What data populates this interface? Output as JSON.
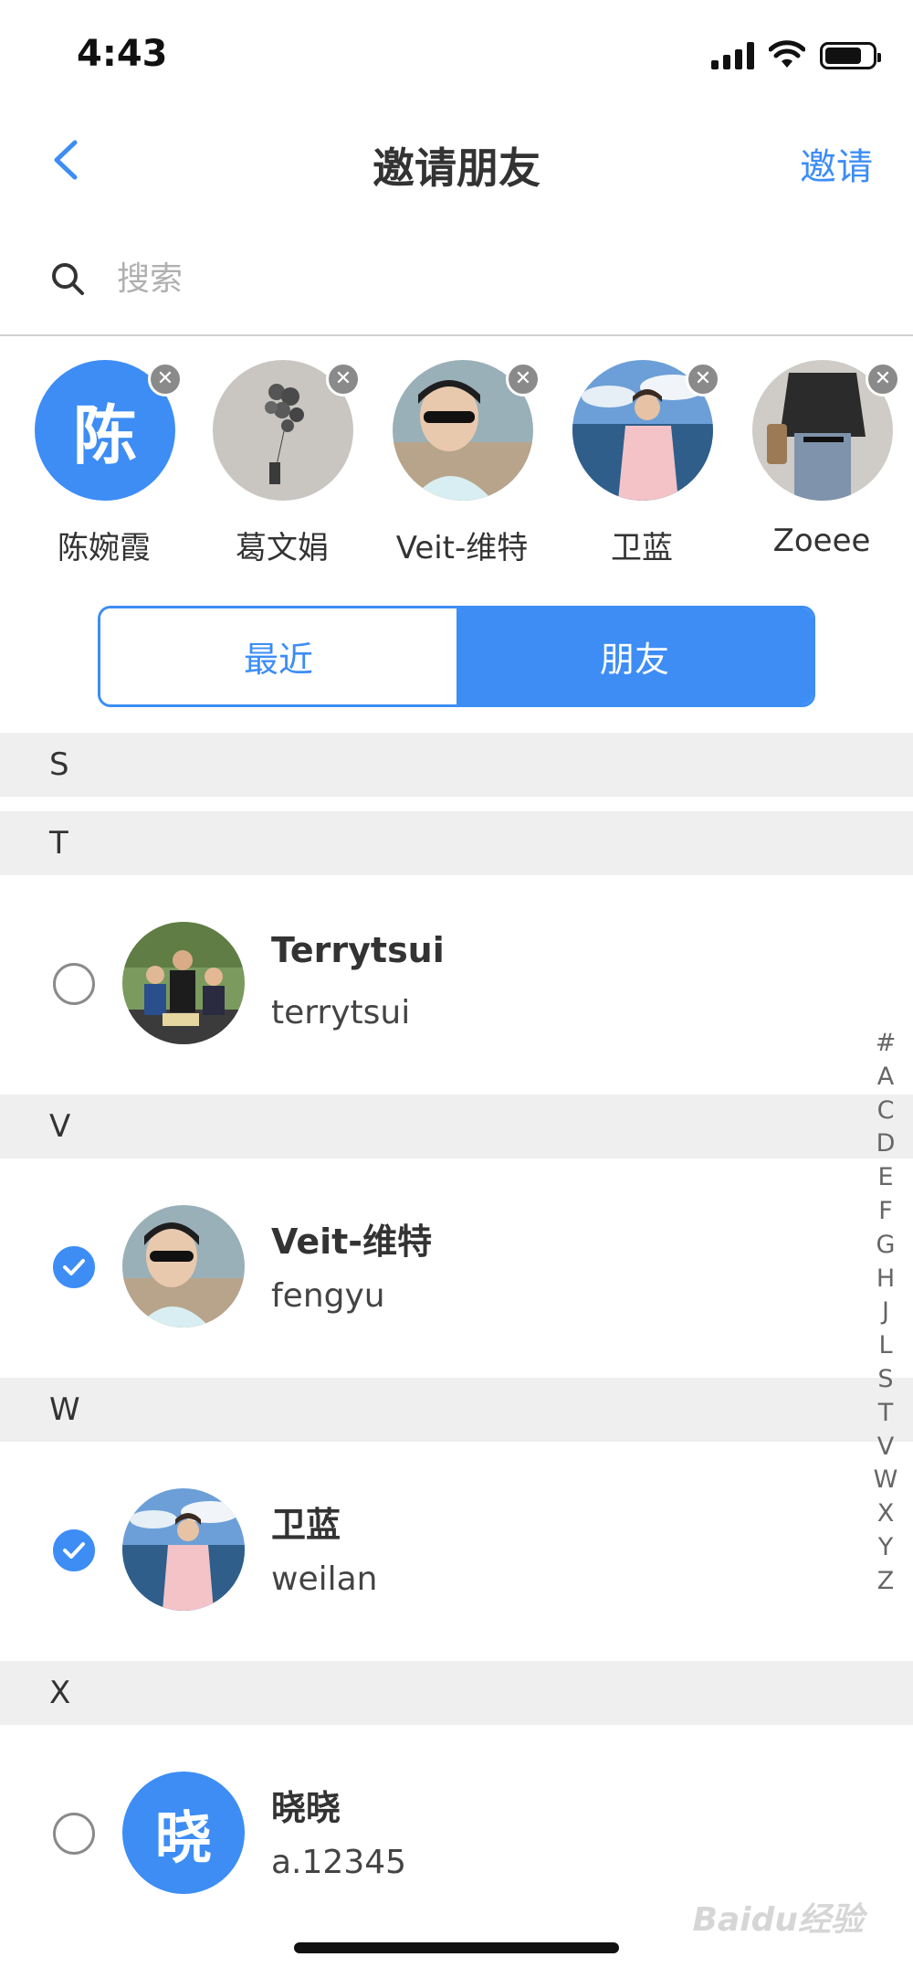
{
  "status_bar": {
    "time": "4:43"
  },
  "nav": {
    "title": "邀请朋友",
    "action_label": "邀请"
  },
  "search": {
    "placeholder": "搜索"
  },
  "selected": [
    {
      "name": "陈婉霞",
      "avatar_text": "陈"
    },
    {
      "name": "葛文娟"
    },
    {
      "name": "Veit-维特"
    },
    {
      "name": "卫蓝"
    },
    {
      "name": "Zoeee"
    }
  ],
  "segment": {
    "tab_recent": "最近",
    "tab_friends": "朋友",
    "active": "朋友"
  },
  "sections": {
    "S": "S",
    "T": "T",
    "V": "V",
    "W": "W",
    "X": "X"
  },
  "contacts": [
    {
      "name": "Terrytsui",
      "id": "terrytsui",
      "checked": false
    },
    {
      "name": "Veit-维特",
      "id": "fengyu",
      "checked": true
    },
    {
      "name": "卫蓝",
      "id": "weilan",
      "checked": true
    },
    {
      "name": "晓晓",
      "id": "a.12345",
      "checked": false,
      "avatar_text": "晓"
    }
  ],
  "index_letters": [
    "#",
    "A",
    "C",
    "D",
    "E",
    "F",
    "G",
    "H",
    "J",
    "L",
    "S",
    "T",
    "V",
    "W",
    "X",
    "Y",
    "Z"
  ],
  "watermark": "Baidu经验",
  "colors": {
    "accent": "#3d8df5",
    "section_bg": "#efefef",
    "remove_badge": "#8a8a8a"
  }
}
